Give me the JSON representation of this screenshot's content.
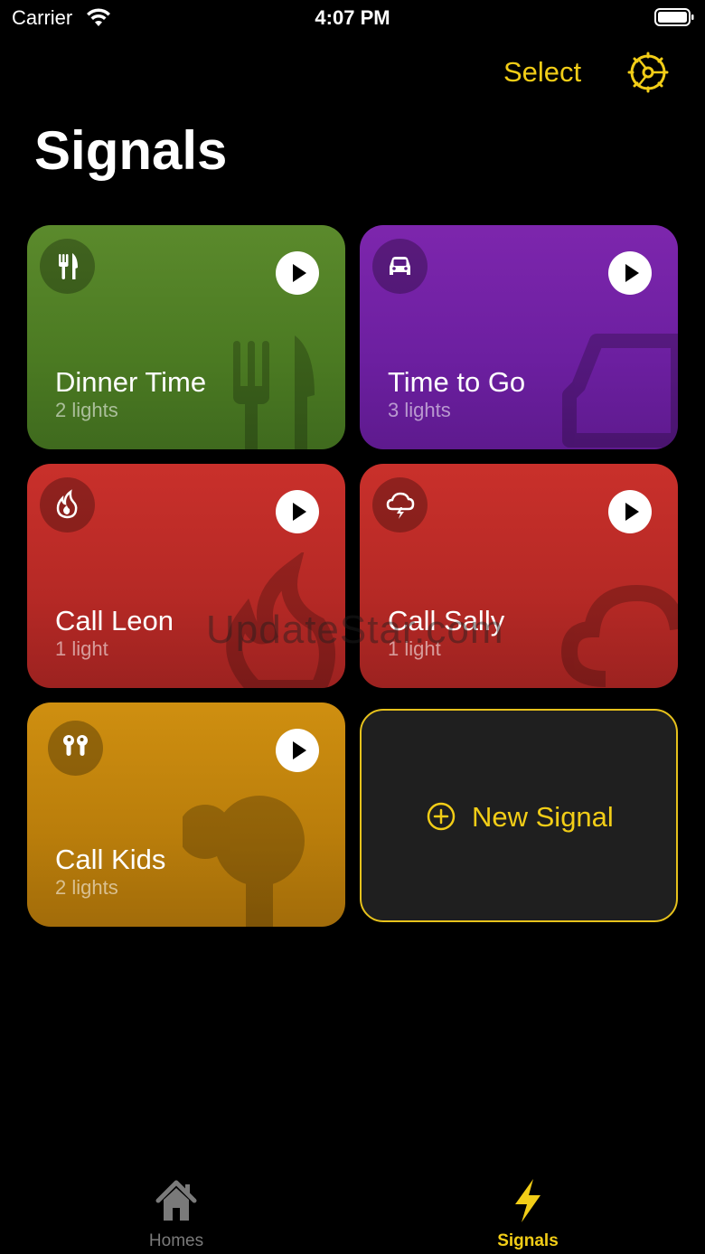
{
  "status": {
    "carrier": "Carrier",
    "time": "4:07 PM"
  },
  "nav": {
    "select_label": "Select"
  },
  "page": {
    "title": "Signals"
  },
  "signals": [
    {
      "name": "Dinner Time",
      "lights": "2 lights",
      "icon": "fork-knife-icon",
      "color": "#4f7f24"
    },
    {
      "name": "Time to Go",
      "lights": "3 lights",
      "icon": "car-icon",
      "color": "#6e21a1"
    },
    {
      "name": "Call Leon",
      "lights": "1 light",
      "icon": "flame-icon",
      "color": "#b72a26"
    },
    {
      "name": "Call Sally",
      "lights": "1 light",
      "icon": "cloud-bolt-icon",
      "color": "#b72a26"
    },
    {
      "name": "Call Kids",
      "lights": "2 lights",
      "icon": "earbuds-icon",
      "color": "#bc7f0c"
    }
  ],
  "new_signal": {
    "label": "New Signal"
  },
  "watermark": "UpdateStar.com",
  "tabs": [
    {
      "label": "Homes",
      "icon": "house-icon",
      "selected": false
    },
    {
      "label": "Signals",
      "icon": "bolt-icon",
      "selected": true
    }
  ],
  "colors": {
    "accent": "#f2cd17",
    "background": "#000000",
    "tab_inactive": "#7a7a7a"
  }
}
